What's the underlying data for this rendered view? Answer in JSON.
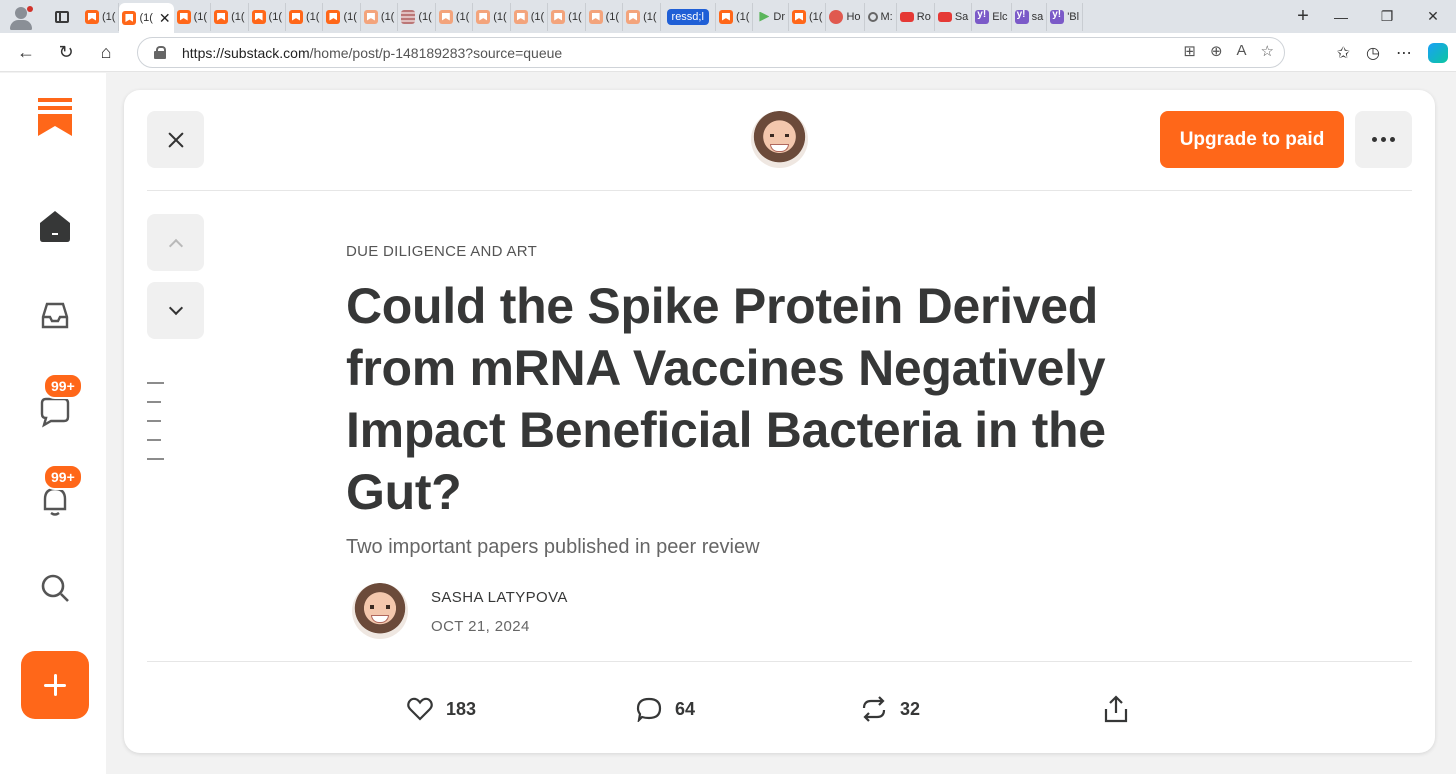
{
  "browser": {
    "active_tab_label": "(1(",
    "tabs": [
      {
        "label": "(1(",
        "icon": "substack-favicon"
      },
      {
        "label": "(1(",
        "icon": "substack-favicon"
      },
      {
        "label": "(1(",
        "icon": "substack-favicon"
      },
      {
        "label": "(1(",
        "icon": "substack-favicon"
      },
      {
        "label": "(1(",
        "icon": "substack-favicon"
      },
      {
        "label": "(1(",
        "icon": "substack-favicon"
      },
      {
        "label": "(1(",
        "icon": "substack-favicon"
      },
      {
        "label": "(1(",
        "icon": "substack-favicon"
      },
      {
        "label": "(1(",
        "icon": "striped-favicon"
      },
      {
        "label": "(1(",
        "icon": "substack-favicon"
      },
      {
        "label": "(1(",
        "icon": "substack-favicon"
      },
      {
        "label": "(1(",
        "icon": "substack-favicon"
      },
      {
        "label": "(1(",
        "icon": "substack-favicon"
      },
      {
        "label": "(1(",
        "icon": "substack-favicon"
      },
      {
        "label": "(1(",
        "icon": "substack-favicon"
      },
      {
        "label": "ressd;l",
        "icon": "pill"
      },
      {
        "label": "(1(",
        "icon": "substack-favicon"
      },
      {
        "label": "Dr",
        "icon": "play-favicon"
      },
      {
        "label": "(1(",
        "icon": "substack-favicon"
      },
      {
        "label": "Ho",
        "icon": "podcast-favicon"
      },
      {
        "label": "M:",
        "icon": "search-favicon"
      },
      {
        "label": "Ro",
        "icon": "youtube-favicon"
      },
      {
        "label": "Sa",
        "icon": "youtube-favicon"
      },
      {
        "label": "Elc",
        "icon": "yahoo-favicon"
      },
      {
        "label": "sa",
        "icon": "yahoo-favicon"
      },
      {
        "label": "'Bl",
        "icon": "yahoo-favicon"
      }
    ],
    "url_host": "https://substack.com",
    "url_path": "/home/post/p-148189283?source=queue"
  },
  "sidebar": {
    "chat_badge": "99+",
    "notifications_badge": "99+"
  },
  "post": {
    "upgrade_label": "Upgrade to paid",
    "section": "DUE DILIGENCE AND ART",
    "title": "Could the Spike Protein Derived from mRNA Vaccines Negatively Impact Beneficial Bacteria in the Gut?",
    "subtitle": "Two important papers published in peer review",
    "author": "SASHA LATYPOVA",
    "date": "OCT 21, 2024",
    "likes": "183",
    "comments": "64",
    "restacks": "32"
  },
  "colors": {
    "accent": "#ff6719",
    "text": "#363737"
  }
}
